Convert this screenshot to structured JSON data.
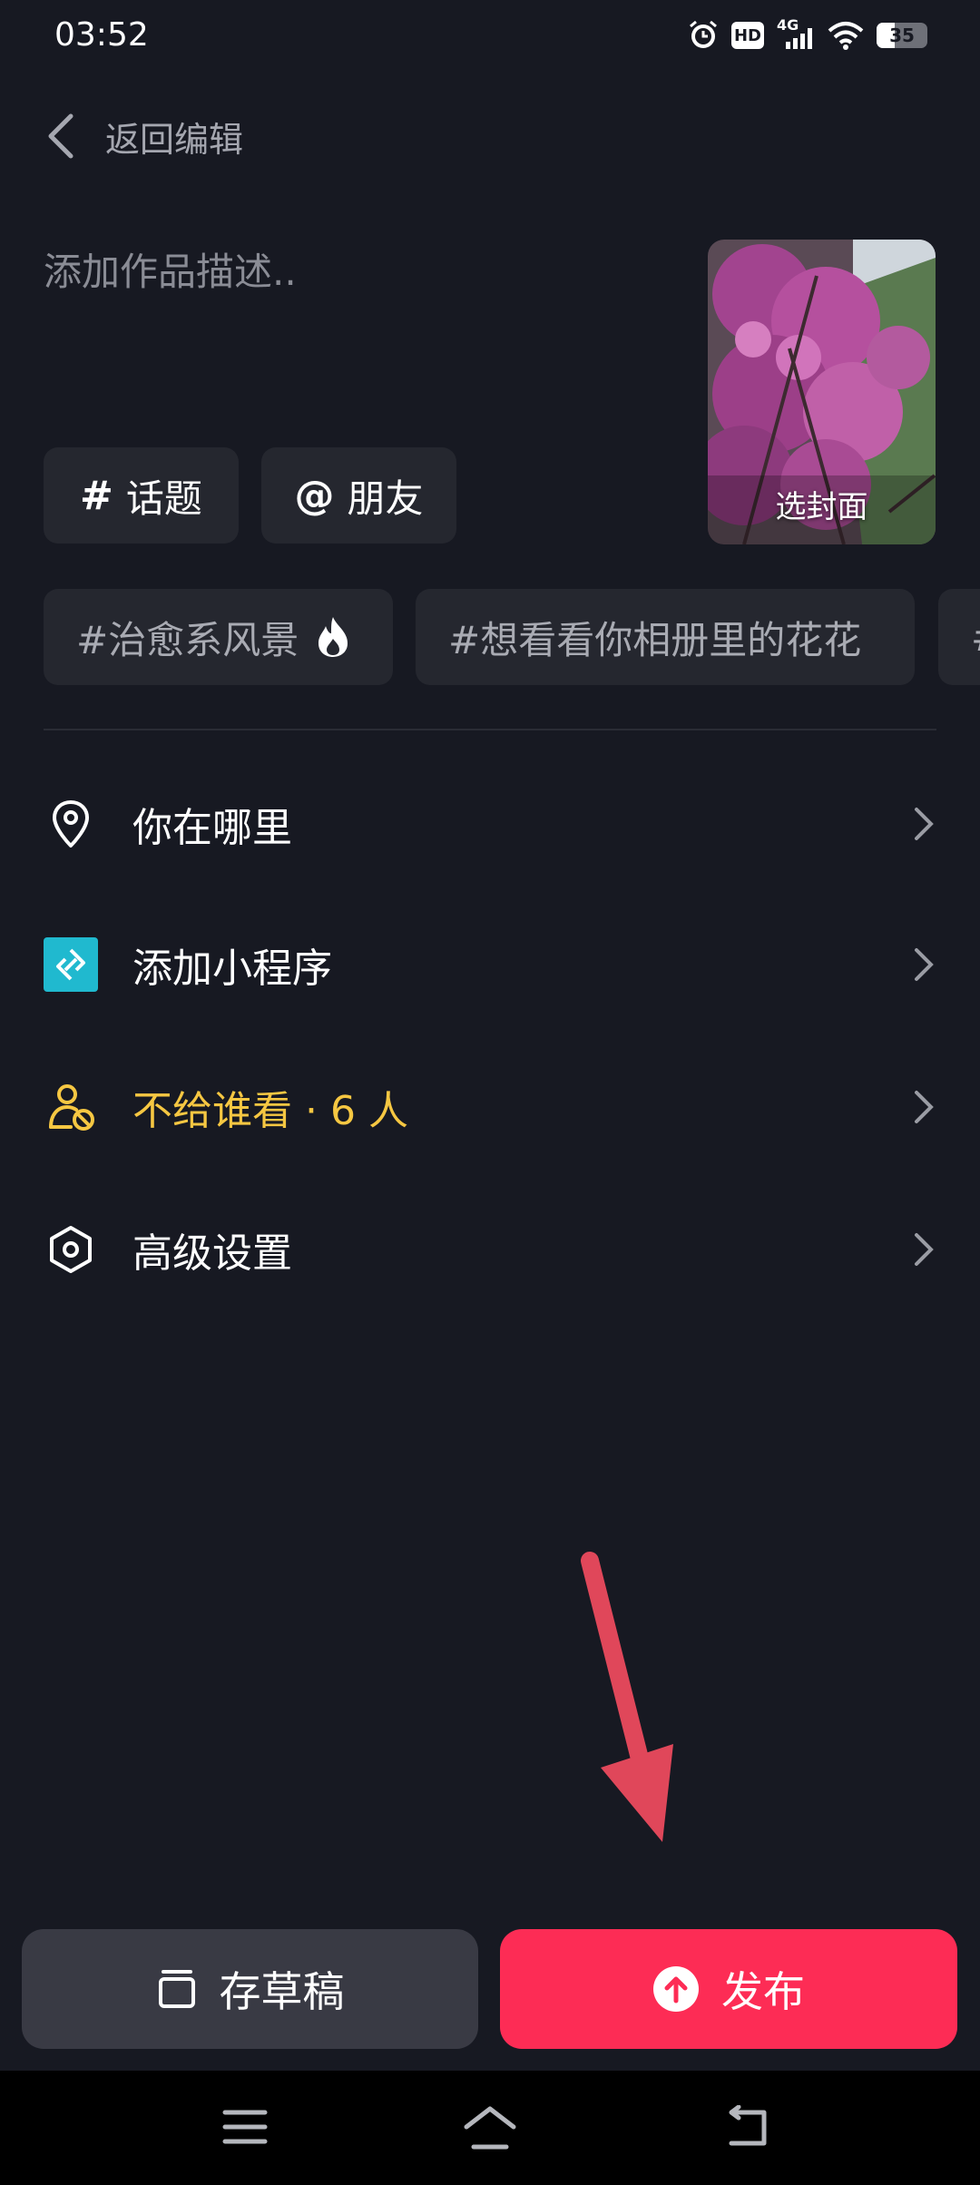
{
  "status_bar": {
    "time": "03:52",
    "hd_label": "HD",
    "network_label": "4G",
    "battery_level": "35",
    "icons": [
      "alarm-icon",
      "hd-icon",
      "signal-4g-icon",
      "wifi-icon",
      "battery-icon"
    ]
  },
  "header": {
    "back_label": "返回编辑"
  },
  "description": {
    "placeholder": "添加作品描述.."
  },
  "cover": {
    "label": "选封面"
  },
  "chips": {
    "topic": {
      "symbol": "#",
      "label": "话题"
    },
    "friend": {
      "symbol": "@",
      "label": "朋友"
    }
  },
  "suggested_tags": [
    "#治愈系风景",
    "#想看看你相册里的花花",
    "#"
  ],
  "settings": {
    "location": {
      "label": "你在哪里",
      "icon": "location-pin-icon"
    },
    "mini_program": {
      "label": "添加小程序",
      "icon": "mini-program-icon"
    },
    "privacy": {
      "label": "不给谁看 · 6 人",
      "icon": "user-block-icon"
    },
    "advanced": {
      "label": "高级设置",
      "icon": "hexagon-settings-icon"
    }
  },
  "buttons": {
    "draft": "存草稿",
    "publish": "发布"
  },
  "colors": {
    "background": "#171922",
    "chip": "#25272f",
    "publish": "#fd2c55",
    "draft": "#393a44",
    "privacy_text": "#f6c742",
    "mini_program_icon": "#20b9cf",
    "annotation_arrow": "#e0475a"
  },
  "nav_bar": {
    "icons": [
      "menu-icon",
      "home-icon",
      "back-icon"
    ]
  }
}
